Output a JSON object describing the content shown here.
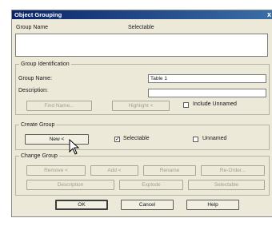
{
  "window": {
    "title": "Object Grouping",
    "close_glyph": "x"
  },
  "list": {
    "col_group_name": "Group Name",
    "col_selectable": "Selectable"
  },
  "group_identification": {
    "legend": "Group Identification",
    "group_name_label": "Group Name:",
    "group_name_value": "Table 1",
    "description_label": "Description:",
    "description_value": "",
    "find_name_button": "Find Name...",
    "highlight_button": "Highlight <",
    "include_unnamed_label": "Include Unnamed",
    "include_unnamed_checked": false
  },
  "create_group": {
    "legend": "Create Group",
    "new_button": "New <",
    "selectable_label": "Selectable",
    "selectable_checked": true,
    "unnamed_label": "Unnamed",
    "unnamed_checked": false
  },
  "change_group": {
    "legend": "Change Group",
    "remove_button": "Remove <",
    "add_button": "Add <",
    "rename_button": "Rename",
    "reorder_button": "Re-Order...",
    "description_button": "Description",
    "explode_button": "Explode",
    "selectable_button": "Selectable"
  },
  "footer": {
    "ok_button": "OK",
    "cancel_button": "Cancel",
    "help_button": "Help"
  },
  "colors": {
    "title_start": "#0a246a",
    "title_end": "#3a6ea5",
    "dialog_bg": "#ece9d8",
    "disabled_text": "#a19f92"
  }
}
